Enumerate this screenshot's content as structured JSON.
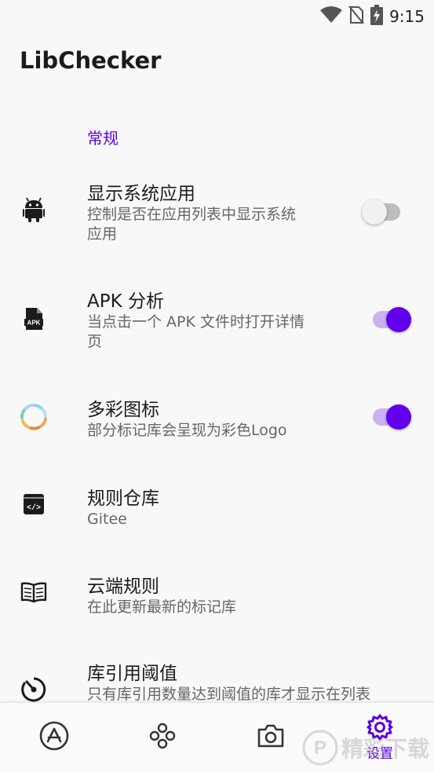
{
  "status_bar": {
    "time": "9:15",
    "icons": [
      "wifi-icon",
      "no-sim-icon",
      "battery-charging-icon"
    ]
  },
  "app": {
    "title": "LibChecker"
  },
  "section": {
    "header": "常规",
    "accent_color": "#5a00e0"
  },
  "prefs": [
    {
      "title": "显示系统应用",
      "summary_lines": [
        "控制是否在应用列表中显示系统",
        "应用"
      ],
      "icon": "android-icon",
      "switch": "off"
    },
    {
      "title": "APK 分析",
      "summary_lines": [
        "当点击一个 APK 文件时打开详情",
        "页"
      ],
      "icon": "apk-file-icon",
      "switch": "on"
    },
    {
      "title": "多彩图标",
      "summary_lines": [
        "部分标记库会呈现为彩色Logo"
      ],
      "icon": "colorful-ring-icon",
      "switch": "on"
    },
    {
      "title": "规则仓库",
      "summary_lines": [
        "Gitee"
      ],
      "icon": "code-repository-icon"
    },
    {
      "title": "云端规则",
      "summary_lines": [
        "在此更新最新的标记库"
      ],
      "icon": "book-icon"
    },
    {
      "title": "库引用阈值",
      "summary_lines": [
        "只有库引用数量达到阈值的库才显示在列表"
      ],
      "icon": "timer-icon"
    }
  ],
  "bottom_nav": {
    "items": [
      {
        "name": "app-store-icon",
        "label": ""
      },
      {
        "name": "statistics-icon",
        "label": ""
      },
      {
        "name": "camera-icon",
        "label": ""
      },
      {
        "name": "gear-icon",
        "label": "设置",
        "selected": true
      }
    ]
  },
  "colors": {
    "primary": "#6200ee",
    "switch_track_on": "#c9b2f2"
  },
  "watermark": {
    "text": "精彩下载"
  }
}
